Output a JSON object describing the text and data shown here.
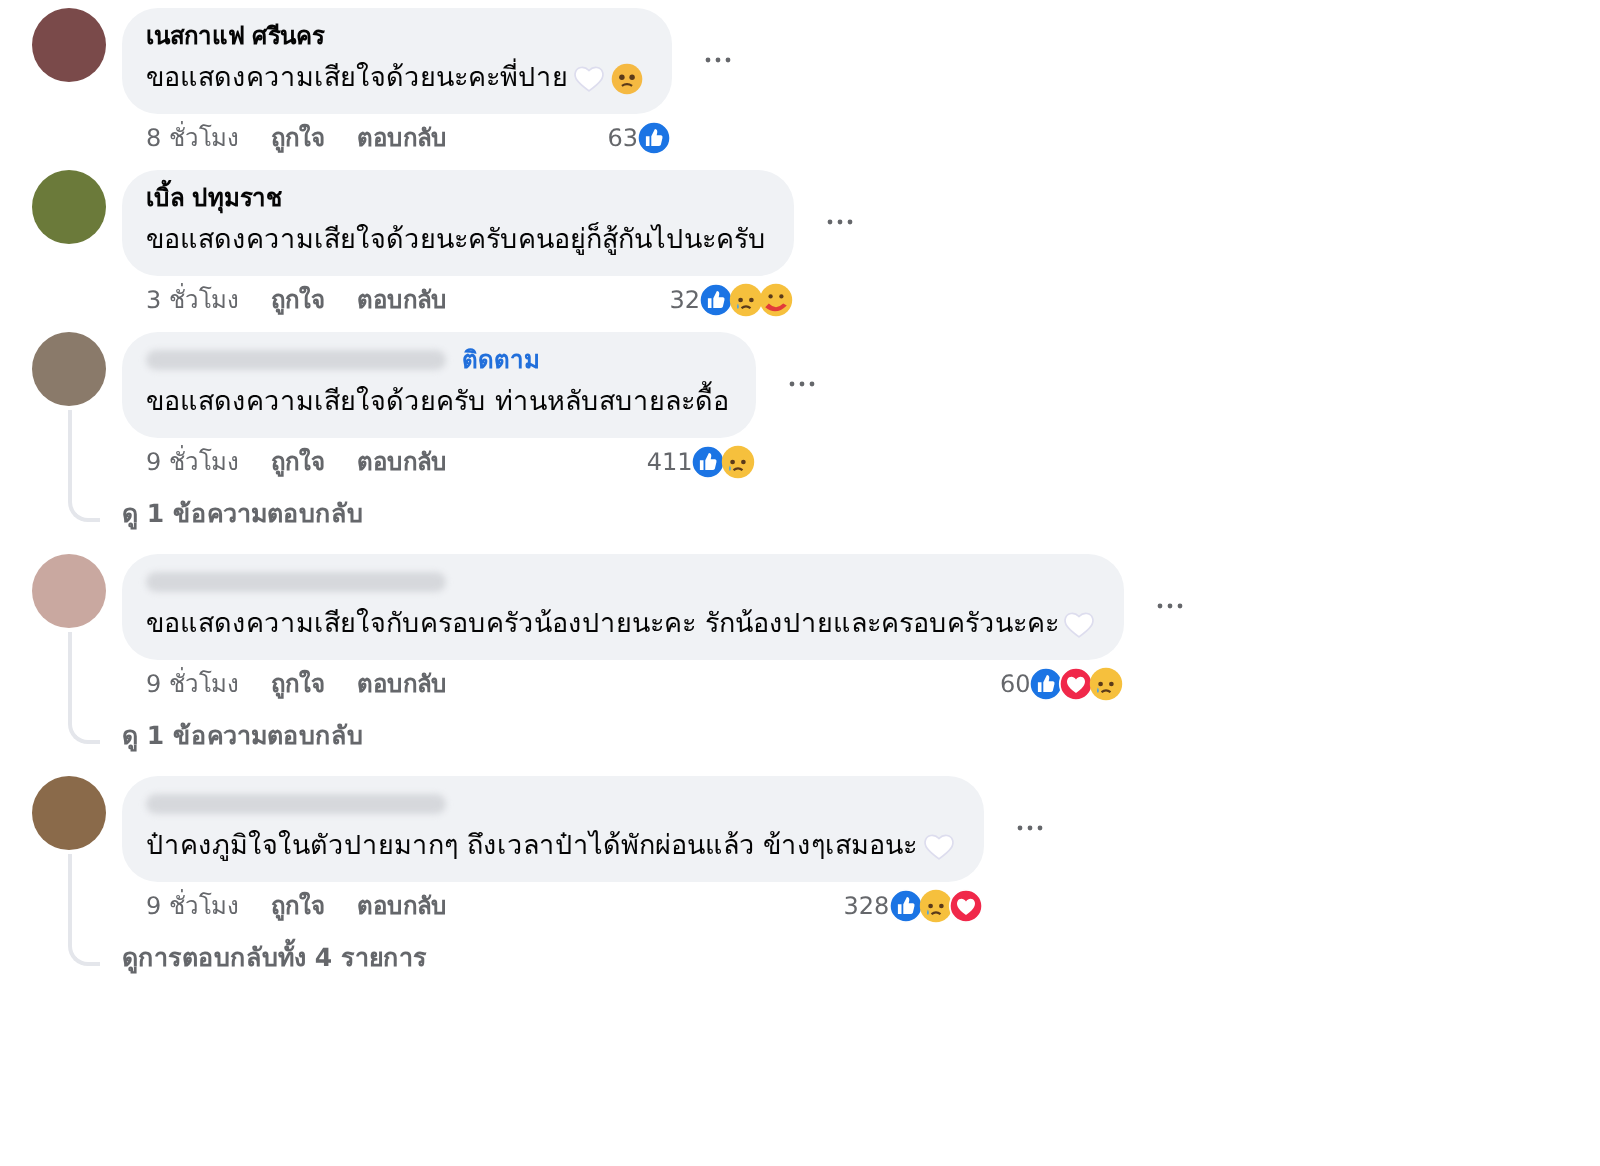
{
  "comments": [
    {
      "name": "เนสกาแฟ ศรีนคร",
      "name_hidden": false,
      "text": "ขอแสดงความเสียใจด้วยนะคะพี่ปาย",
      "trailing": [
        {
          "kind": "white_heart"
        },
        {
          "kind": "sad"
        }
      ],
      "time": "8 ชั่วโมง",
      "like": "ถูกใจ",
      "reply": "ตอบกลับ",
      "count": "63",
      "reactions": [
        {
          "kind": "like"
        }
      ]
    },
    {
      "name": "เบิ้ล ปทุมราช",
      "name_hidden": false,
      "text": "ขอแสดงความเสียใจด้วยนะครับคนอยู่ก็สู้กันไปนะครับ",
      "time": "3 ชั่วโมง",
      "like": "ถูกใจ",
      "reply": "ตอบกลับ",
      "count": "32",
      "reactions": [
        {
          "kind": "like"
        },
        {
          "kind": "sad"
        },
        {
          "kind": "care"
        }
      ]
    },
    {
      "name_hidden": true,
      "follow": "ติดตาม",
      "text": "ขอแสดงความเสียใจด้วยครับ ท่านหลับสบายละดื้อ",
      "time": "9 ชั่วโมง",
      "like": "ถูกใจ",
      "reply": "ตอบกลับ",
      "count": "411",
      "reactions": [
        {
          "kind": "like"
        },
        {
          "kind": "sad"
        }
      ],
      "replies": "ดู 1 ข้อความตอบกลับ"
    },
    {
      "name_hidden": true,
      "text": "ขอแสดงความเสียใจกับครอบครัวน้องปายนะคะ รักน้องปายและครอบครัวนะคะ",
      "trailing": [
        {
          "kind": "white_heart"
        }
      ],
      "time": "9 ชั่วโมง",
      "like": "ถูกใจ",
      "reply": "ตอบกลับ",
      "count": "60",
      "reactions": [
        {
          "kind": "like"
        },
        {
          "kind": "love"
        },
        {
          "kind": "sad"
        }
      ],
      "replies": "ดู 1 ข้อความตอบกลับ"
    },
    {
      "name_hidden": true,
      "text": "ป๋าคงภูมิใจในตัวปายมากๆ ถึงเวลาป๋าได้พักผ่อนแล้ว ข้างๆเสมอนะ",
      "trailing": [
        {
          "kind": "white_heart"
        }
      ],
      "time": "9 ชั่วโมง",
      "like": "ถูกใจ",
      "reply": "ตอบกลับ",
      "count": "328",
      "reactions": [
        {
          "kind": "like"
        },
        {
          "kind": "sad"
        },
        {
          "kind": "love"
        }
      ],
      "replies": "ดูการตอบกลับทั้ง 4 รายการ"
    }
  ]
}
